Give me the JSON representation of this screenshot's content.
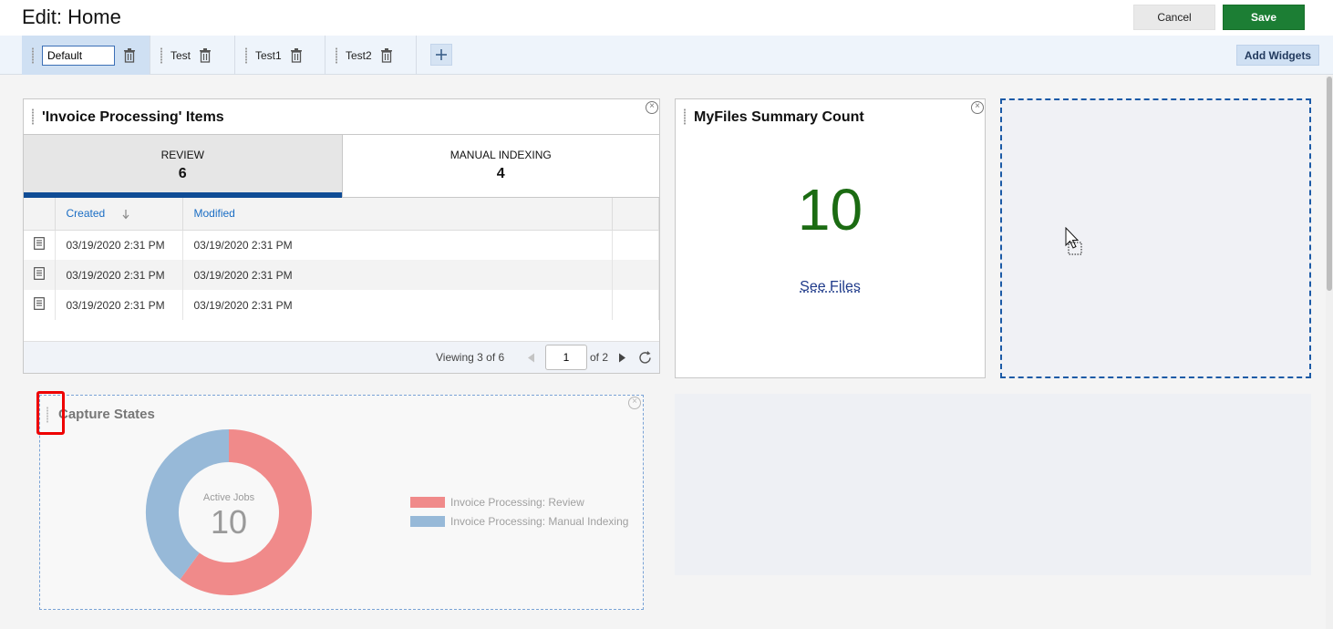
{
  "header": {
    "title": "Edit: Home",
    "cancel_label": "Cancel",
    "save_label": "Save"
  },
  "tabs": [
    {
      "label": "Default",
      "active": true,
      "editing": true
    },
    {
      "label": "Test"
    },
    {
      "label": "Test1"
    },
    {
      "label": "Test2"
    }
  ],
  "toolbar": {
    "add_widgets_label": "Add Widgets"
  },
  "invoice_widget": {
    "title": "'Invoice Processing' Items",
    "tabs": [
      {
        "label": "REVIEW",
        "count": "6"
      },
      {
        "label": "MANUAL INDEXING",
        "count": "4"
      }
    ],
    "columns": [
      "Created",
      "Modified"
    ],
    "rows": [
      {
        "created": "03/19/2020 2:31 PM",
        "modified": "03/19/2020 2:31 PM"
      },
      {
        "created": "03/19/2020 2:31 PM",
        "modified": "03/19/2020 2:31 PM"
      },
      {
        "created": "03/19/2020 2:31 PM",
        "modified": "03/19/2020 2:31 PM"
      }
    ],
    "pager": {
      "viewing_prefix": "Viewing ",
      "viewing_count": "3 of 6",
      "page": "1",
      "of_text": "of 2"
    }
  },
  "myfiles_widget": {
    "title": "MyFiles Summary Count",
    "count": "10",
    "link_label": "See Files"
  },
  "capture_widget": {
    "title": "Capture States",
    "center_label": "Active Jobs",
    "center_value": "10",
    "legend": [
      {
        "label": "Invoice Processing: Review",
        "color": "#f08a8a"
      },
      {
        "label": "Invoice Processing: Manual Indexing",
        "color": "#97b9d8"
      }
    ],
    "slices": [
      {
        "name": "Invoice Processing: Review",
        "value": 6
      },
      {
        "name": "Invoice Processing: Manual Indexing",
        "value": 4
      }
    ]
  },
  "colors": {
    "accent_green": "#1c7e34",
    "link_blue": "#1a6dc4",
    "tab_active": "#0f4c95"
  }
}
